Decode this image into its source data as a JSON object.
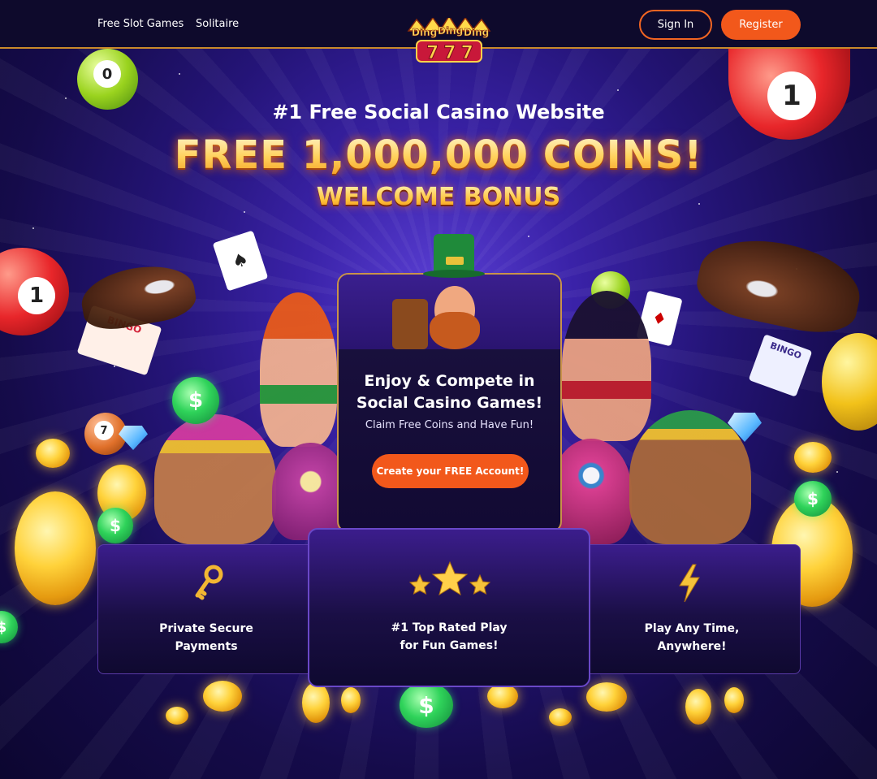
{
  "nav": {
    "links": [
      "Free Slot Games",
      "Solitaire"
    ],
    "logo_text": [
      "Ding",
      "Ding",
      "Ding",
      "777"
    ],
    "sign_in": "Sign In",
    "register": "Register"
  },
  "hero": {
    "subtitle": "#1 Free Social Casino Website",
    "headline": "FREE 1,000,000 COINS!",
    "bonus": "WELCOME BONUS"
  },
  "main_card": {
    "title_line1": "Enjoy & Compete in",
    "title_line2": "Social Casino Games!",
    "subtitle": "Claim Free Coins and Have Fun!",
    "cta": "Create your FREE Account!"
  },
  "features": [
    {
      "line1": "Private Secure",
      "line2": "Payments",
      "icon": "key-icon"
    },
    {
      "line1": "#1 Top Rated Play",
      "line2": "for Fun Games!",
      "icon": "stars-icon"
    },
    {
      "line1": "Play Any Time,",
      "line2": "Anywhere!",
      "icon": "lightning-icon"
    }
  ],
  "decor": {
    "bingo_label": "BINGO",
    "ball_numbers": [
      "0",
      "1",
      "1",
      "7"
    ],
    "coin_symbol": "$",
    "card_suit_spade": "♠",
    "card_suit_diamond": "♦"
  },
  "colors": {
    "accent": "#f2581b",
    "header_bg": "#0e0a2c",
    "gold": "#ffd15a",
    "card_border": "#c9934a"
  }
}
